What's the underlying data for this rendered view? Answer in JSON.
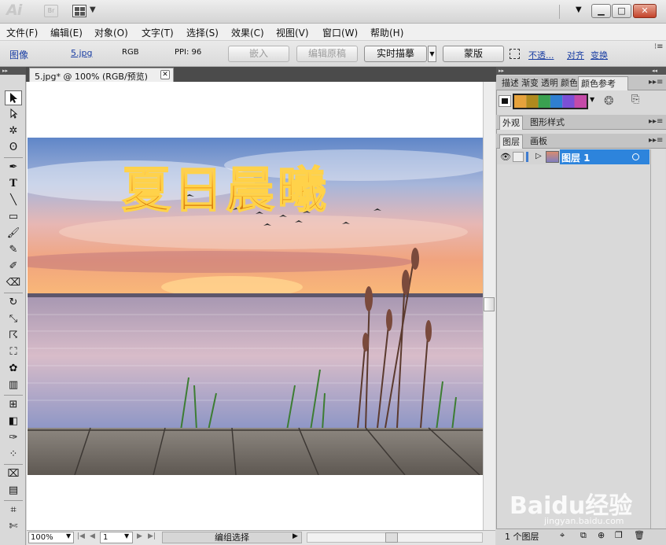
{
  "app": {
    "logo": "Ai",
    "bridge_label": "Br",
    "dropdown_glyph": "▼",
    "minimize": "▁",
    "maximize": "□",
    "close": "✕"
  },
  "menu": [
    "文件(F)",
    "编辑(E)",
    "对象(O)",
    "文字(T)",
    "选择(S)",
    "效果(C)",
    "视图(V)",
    "窗口(W)",
    "帮助(H)"
  ],
  "control": {
    "type_label": "图像",
    "file_name": "5.jpg",
    "color_mode": "RGB",
    "ppi": "PPI: 96",
    "embed": "嵌入",
    "edit_original": "编辑原稿",
    "live_trace": "实时描摹",
    "mask": "蒙版",
    "opacity": "不透...",
    "align": "对齐",
    "transform": "变换"
  },
  "document": {
    "tab_title": "5.jpg* @ 100% (RGB/预览)",
    "close_glyph": "✕",
    "art_title": "夏日晨曦"
  },
  "status": {
    "zoom": "100%",
    "page": "1",
    "tool_name": "编组选择"
  },
  "panels": {
    "top_tabs": [
      "描述",
      "渐变",
      "透明",
      "颜色",
      "颜色参考"
    ],
    "mid_tabs": [
      "外观",
      "图形样式"
    ],
    "layer_tabs": [
      "图层",
      "画板"
    ],
    "layer_name": "图层 1",
    "layer_count": "1 个图层"
  },
  "swatch_colors": [
    "#e6a23c",
    "#b08a1e",
    "#3aa050",
    "#2f7fd1",
    "#7b4fd6",
    "#c44aa8"
  ],
  "watermark": {
    "brand": "Baidu经验",
    "url": "jingyan.baidu.com"
  },
  "icons": [
    "selection-tool",
    "direct-selection-tool",
    "magic-wand-tool",
    "lasso-tool",
    "pen-tool",
    "type-tool",
    "line-tool",
    "rectangle-tool",
    "paintbrush-tool",
    "pencil-tool",
    "blob-brush-tool",
    "eraser-tool",
    "rotate-tool",
    "scale-tool",
    "warp-tool",
    "free-transform-tool",
    "symbol-sprayer-tool",
    "graph-tool",
    "mesh-tool",
    "gradient-tool",
    "eyedropper-tool",
    "blend-tool",
    "live-paint-tool",
    "artboard-tool",
    "slice-tool"
  ]
}
